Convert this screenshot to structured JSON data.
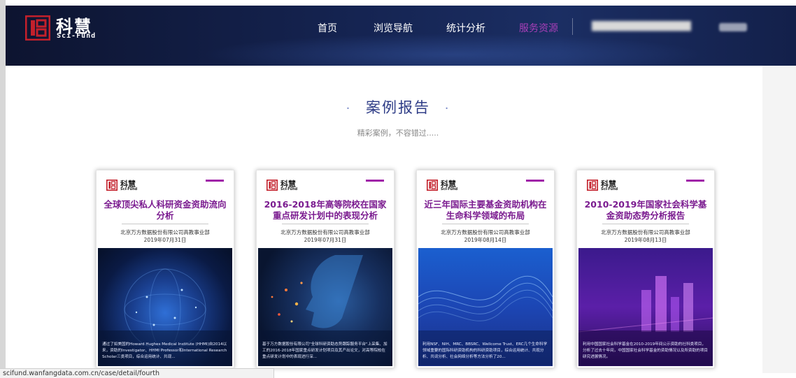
{
  "brand": {
    "name": "科慧",
    "subtitle": "Sci-Fund",
    "accent": "#c3202b"
  },
  "nav": {
    "items": [
      {
        "label": "首页"
      },
      {
        "label": "浏览导航"
      },
      {
        "label": "统计分析"
      },
      {
        "label": "服务资源",
        "active": true
      }
    ]
  },
  "section": {
    "title": "案例报告",
    "dot": "·",
    "subtitle": "精彩案例，不容错过....."
  },
  "cards": [
    {
      "brand": "科慧",
      "brand_sub": "Sci-Fund",
      "title": "全球顶尖私人科研资金资助流向分析",
      "org": "北京万方数据股份有限公司高教事业部",
      "date": "2019年07月31日",
      "desc": "通过了如美国的Howard Hughes Medical Institute (HHMI)自2014以来，资助的Investigator、HHMI Professor和International Research Scholar三类项目，综合运用统计、共现..."
    },
    {
      "brand": "科慧",
      "brand_sub": "Sci-Fund",
      "title": "2016-2018年高等院校在国家重点研发计划中的表现分析",
      "org": "北京万方数据股份有限公司高教事业部",
      "date": "2019年07月31日",
      "desc": "基于万方数据股份有限公司\"全球科研资助态势跟踪服务平台\"上采集、加工的2016-2018年国家重点研发计划项目及其产出论文，对高等院校在重点研发计划中的表现进行深..."
    },
    {
      "brand": "科慧",
      "brand_sub": "Sci-Fund",
      "title": "近三年国际主要基金资助机构在生命科学领域的布局",
      "org": "北京万方数据股份有限公司高教事业部",
      "date": "2019年08月14日",
      "desc": "利用NSF、NIH、MRC、BBSRC、Wellcome Trust、ERC几个生命科学领域重要的国际科研资助机构的科研资助项目，综合运用统计、共现分析、共词分析、社会网络分析等方法分析了20..."
    },
    {
      "brand": "科慧",
      "brand_sub": "Sci-Fund",
      "title": "2010-2019年国家社会科学基金资助态势分析报告",
      "org": "北京万方数据股份有限公司高教事业部",
      "date": "2019年08月13日",
      "desc": "利用中国国家社会科学基金在2010-2019年间公示资助的社科类项目，分析了过去十年间，中国国家社会科学基金的资助情况以及所资助的项目研究进展情况。"
    }
  ],
  "status_bar": {
    "url": "scifund.wanfangdata.com.cn/case/detail/fourth"
  },
  "colors": {
    "nav_active": "#a83fb8",
    "card_title": "#7a1a8f",
    "section_title": "#2f3d87"
  }
}
